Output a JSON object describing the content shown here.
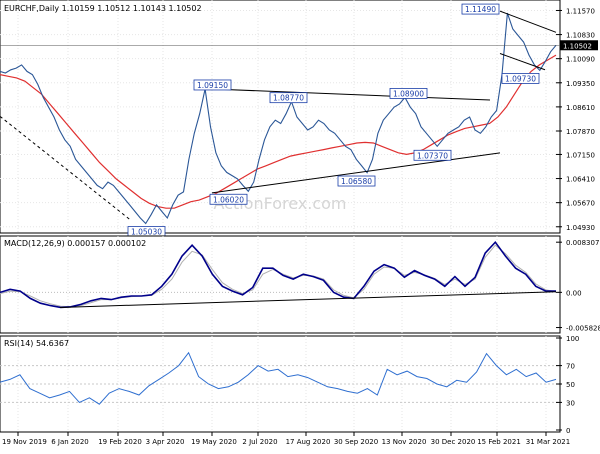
{
  "chart_data": [
    {
      "type": "line",
      "panel": "price",
      "title": "EURCHF,Daily  1.10159 1.10512 1.10143 1.10502",
      "current_price_label": "1.10502",
      "watermark": "ActionForex.com",
      "ylim": [
        1.048,
        1.1183
      ],
      "y_ticks": [
        "1.11570",
        "1.10830",
        "1.10090",
        "1.09350",
        "1.08610",
        "1.07870",
        "1.07150",
        "1.06410",
        "1.05670",
        "1.04930"
      ],
      "grid": true,
      "x_tick_labels": [
        "19 Nov 2019",
        "6 Jan 2020",
        "19 Feb 2020",
        "3 Apr 2020",
        "19 May 2020",
        "2 Jul 2020",
        "17 Aug 2020",
        "30 Sep 2020",
        "13 Nov 2020",
        "30 Dec 2020",
        "15 Feb 2021",
        "31 Mar 2021"
      ],
      "series": [
        {
          "kind": "close",
          "color": "#2b5797",
          "values": [
            1.097,
            1.0965,
            1.0975,
            1.098,
            1.099,
            1.097,
            1.096,
            1.093,
            1.089,
            1.086,
            1.083,
            1.079,
            1.076,
            1.074,
            1.07,
            1.068,
            1.066,
            1.064,
            1.062,
            1.061,
            1.063,
            1.062,
            1.06,
            1.058,
            1.056,
            1.054,
            1.052,
            1.0503,
            1.053,
            1.056,
            1.054,
            1.052,
            1.056,
            1.059,
            1.06,
            1.07,
            1.078,
            1.084,
            1.0916,
            1.08,
            1.072,
            1.068,
            1.066,
            1.065,
            1.064,
            1.062,
            1.0602,
            1.063,
            1.07,
            1.076,
            1.08,
            1.082,
            1.081,
            1.084,
            1.0877,
            1.083,
            1.081,
            1.079,
            1.08,
            1.082,
            1.081,
            1.079,
            1.078,
            1.076,
            1.074,
            1.073,
            1.07,
            1.068,
            1.0659,
            1.07,
            1.078,
            1.082,
            1.084,
            1.086,
            1.087,
            1.089,
            1.086,
            1.084,
            1.08,
            1.078,
            1.076,
            1.074,
            1.076,
            1.078,
            1.079,
            1.08,
            1.082,
            1.083,
            1.079,
            1.078,
            1.08,
            1.083,
            1.085,
            1.096,
            1.1149,
            1.11,
            1.108,
            1.106,
            1.102,
            1.099,
            1.0973,
            1.1,
            1.103,
            1.105
          ]
        },
        {
          "kind": "moving-average",
          "color": "#e03030",
          "values": [
            1.096,
            1.0955,
            1.095,
            1.094,
            1.092,
            1.09,
            1.087,
            1.084,
            1.081,
            1.078,
            1.075,
            1.072,
            1.069,
            1.0665,
            1.064,
            1.062,
            1.06,
            1.058,
            1.0565,
            1.0555,
            1.055,
            1.055,
            1.056,
            1.057,
            1.0575,
            1.0585,
            1.0595,
            1.061,
            1.0625,
            1.064,
            1.0655,
            1.067,
            1.068,
            1.069,
            1.07,
            1.071,
            1.0715,
            1.072,
            1.0725,
            1.073,
            1.0735,
            1.074,
            1.0745,
            1.075,
            1.0752,
            1.075,
            1.074,
            1.073,
            1.072,
            1.0715,
            1.072,
            1.073,
            1.0745,
            1.076,
            1.0775,
            1.0785,
            1.0795,
            1.08,
            1.0805,
            1.081,
            1.083,
            1.086,
            1.09,
            1.094,
            1.097,
            1.099,
            1.1005,
            1.102
          ]
        }
      ],
      "annotations": [
        "1.05030",
        "1.09150",
        "1.06020",
        "1.08770",
        "1.06580",
        "1.08900",
        "1.07370",
        "1.11490",
        "1.09730"
      ]
    },
    {
      "type": "line",
      "panel": "macd",
      "title": "MACD(12,26,9) 0.000157 0.000102",
      "ylim": [
        -0.0064,
        0.009
      ],
      "y_ticks": [
        "0.008307",
        "0.00",
        "-0.005828"
      ],
      "series": [
        {
          "kind": "macd",
          "color": "#00008b",
          "values": [
            0.0,
            0.0005,
            0.0002,
            -0.001,
            -0.0018,
            -0.0022,
            -0.0025,
            -0.0024,
            -0.002,
            -0.0014,
            -0.001,
            -0.0012,
            -0.0008,
            -0.0006,
            -0.0006,
            -0.0004,
            0.001,
            0.003,
            0.006,
            0.0078,
            0.006,
            0.003,
            0.001,
            0.0002,
            -0.0004,
            0.0008,
            0.004,
            0.004,
            0.0028,
            0.0022,
            0.003,
            0.0026,
            0.002,
            0.0,
            -0.0008,
            -0.001,
            0.001,
            0.0035,
            0.0046,
            0.004,
            0.0025,
            0.0036,
            0.0028,
            0.0022,
            0.001,
            0.0026,
            0.001,
            0.0025,
            0.0065,
            0.0083,
            0.006,
            0.004,
            0.003,
            0.001,
            0.0002,
            0.0002
          ]
        },
        {
          "kind": "signal",
          "color": "#b0b0b0",
          "values": [
            -0.0002,
            0.0002,
            0.0001,
            -0.0006,
            -0.0014,
            -0.0019,
            -0.0023,
            -0.0024,
            -0.0022,
            -0.0017,
            -0.0012,
            -0.0012,
            -0.0009,
            -0.0007,
            -0.0006,
            -0.0005,
            0.0005,
            0.0022,
            0.005,
            0.0068,
            0.0062,
            0.0038,
            0.0016,
            0.0005,
            -0.0002,
            0.0004,
            0.003,
            0.0038,
            0.003,
            0.0024,
            0.0028,
            0.0027,
            0.0022,
            0.0004,
            -0.0005,
            -0.0009,
            0.0005,
            0.003,
            0.0042,
            0.004,
            0.0028,
            0.0033,
            0.0029,
            0.0023,
            0.0013,
            0.0022,
            0.0013,
            0.0022,
            0.0058,
            0.0078,
            0.0064,
            0.0045,
            0.0033,
            0.0014,
            0.0004,
            0.0001
          ]
        }
      ]
    },
    {
      "type": "line",
      "panel": "rsi",
      "title": "RSI(14) 54.6367",
      "ylim": [
        0,
        100
      ],
      "y_ticks": [
        "100",
        "70",
        "50",
        "30",
        "0"
      ],
      "series": [
        {
          "kind": "rsi",
          "color": "#2f6fd0",
          "values": [
            52,
            55,
            60,
            45,
            40,
            35,
            38,
            42,
            30,
            35,
            28,
            40,
            45,
            42,
            38,
            48,
            55,
            62,
            70,
            84,
            58,
            50,
            45,
            47,
            52,
            60,
            70,
            64,
            66,
            58,
            60,
            57,
            52,
            47,
            45,
            42,
            40,
            45,
            38,
            66,
            60,
            64,
            58,
            56,
            50,
            47,
            54,
            52,
            63,
            83,
            70,
            60,
            66,
            58,
            62,
            52,
            55
          ]
        }
      ]
    }
  ]
}
